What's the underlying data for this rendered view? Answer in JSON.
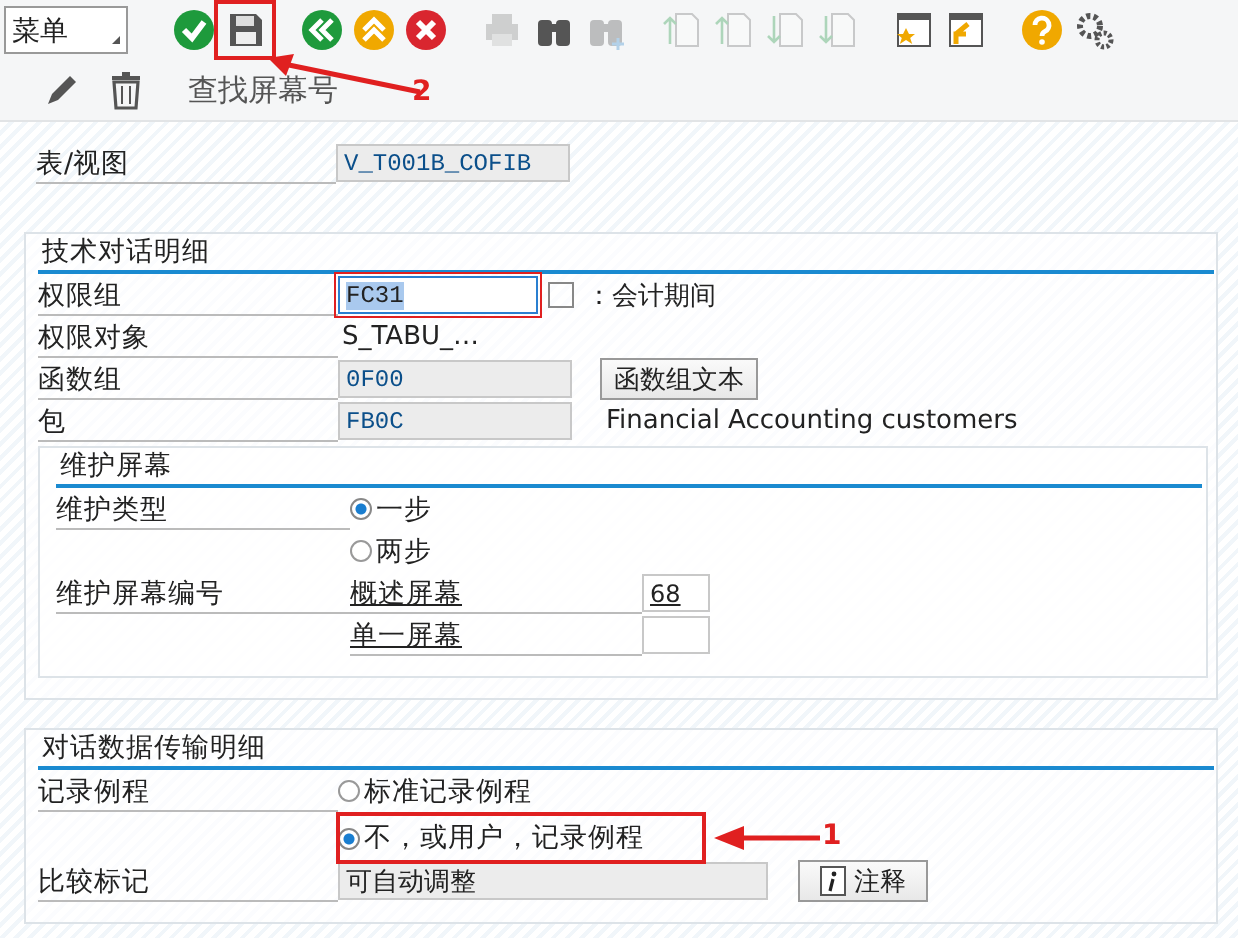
{
  "toolbar": {
    "menu": "菜单",
    "icons": [
      {
        "kind": "check",
        "disabled": false
      },
      {
        "kind": "save",
        "disabled": false
      },
      {
        "kind": "back",
        "disabled": false
      },
      {
        "kind": "exit",
        "disabled": false
      },
      {
        "kind": "cancel",
        "disabled": false
      },
      {
        "kind": "print",
        "disabled": true
      },
      {
        "kind": "find",
        "disabled": false
      },
      {
        "kind": "find_next",
        "disabled": true
      },
      {
        "kind": "first_page",
        "disabled": true
      },
      {
        "kind": "prev_page",
        "disabled": true
      },
      {
        "kind": "next_page",
        "disabled": true
      },
      {
        "kind": "last_page",
        "disabled": true
      },
      {
        "kind": "new_session",
        "disabled": false
      },
      {
        "kind": "shortcut",
        "disabled": false
      },
      {
        "kind": "help",
        "disabled": false
      },
      {
        "kind": "settings",
        "disabled": false
      }
    ]
  },
  "app_toolbar": {
    "icons": [
      {
        "kind": "edit"
      },
      {
        "kind": "delete"
      }
    ],
    "button": "查找屏幕号"
  },
  "table_view": {
    "label": "表/视图",
    "value": "V_T001B_COFIB"
  },
  "tech_details": {
    "title": "技术对话明细",
    "auth_group": {
      "label": "权限组",
      "value": "FC31",
      "description": "：会计期间"
    },
    "auth_object": {
      "label": "权限对象",
      "value": "S_TABU_…"
    },
    "function_group": {
      "label": "函数组",
      "value": "0F00",
      "button": "函数组文本"
    },
    "package": {
      "label": "包",
      "value": "FB0C",
      "description": "Financial Accounting customers"
    },
    "maintenance_screens": {
      "title": "维护屏幕",
      "type_label": "维护类型",
      "types": [
        {
          "label": "一步",
          "selected": true
        },
        {
          "label": "两步",
          "selected": false
        }
      ],
      "numbers_label": "维护屏幕编号",
      "screens": [
        {
          "label": "概述屏幕",
          "value": "68"
        },
        {
          "label": "单一屏幕"
        }
      ]
    }
  },
  "transfer_details": {
    "title": "对话数据传输明细",
    "recording_label": "记录例程",
    "routines": [
      {
        "label": "标准记录例程",
        "selected": false
      },
      {
        "label": "不，或用户，记录例程",
        "selected": true
      }
    ],
    "compare_label": "比较标记",
    "compare_value": "可自动调整",
    "note_button": "注释"
  },
  "annotations": [
    {
      "label": "2"
    },
    {
      "label": "1"
    }
  ]
}
